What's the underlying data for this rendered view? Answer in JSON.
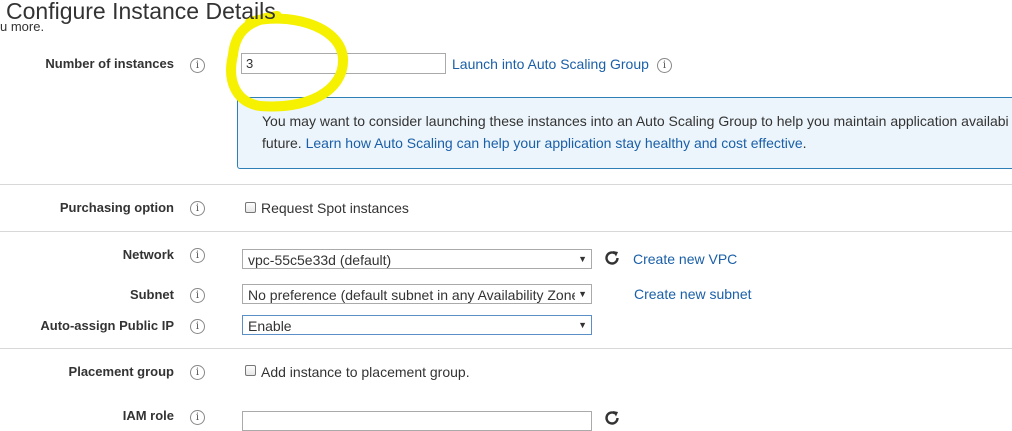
{
  "page": {
    "title": "Configure Instance Details",
    "subtitle_fragment": "u more."
  },
  "instances": {
    "label": "Number of instances",
    "value": "3",
    "asg_link": "Launch into Auto Scaling Group",
    "info_text_line1": "You may want to consider launching these instances into an Auto Scaling Group to help you maintain application availabi",
    "info_text_line2_prefix": "future.",
    "info_link": "Learn how Auto Scaling can help your application stay healthy and cost effective",
    "info_text_suffix": "."
  },
  "purchasing": {
    "label": "Purchasing option",
    "checkbox_label": "Request Spot instances",
    "checked": false
  },
  "network": {
    "label": "Network",
    "selected": "vpc-55c5e33d (default)",
    "create_link": "Create new VPC"
  },
  "subnet": {
    "label": "Subnet",
    "selected": "No preference (default subnet in any Availability Zone",
    "create_link": "Create new subnet"
  },
  "public_ip": {
    "label": "Auto-assign Public IP",
    "selected": "Enable"
  },
  "placement": {
    "label": "Placement group",
    "checkbox_label": "Add instance to placement group.",
    "checked": false
  },
  "iam": {
    "label": "IAM role"
  },
  "icons": {
    "info": "i",
    "refresh": "refresh-icon",
    "highlight_color": "#f5f100"
  }
}
